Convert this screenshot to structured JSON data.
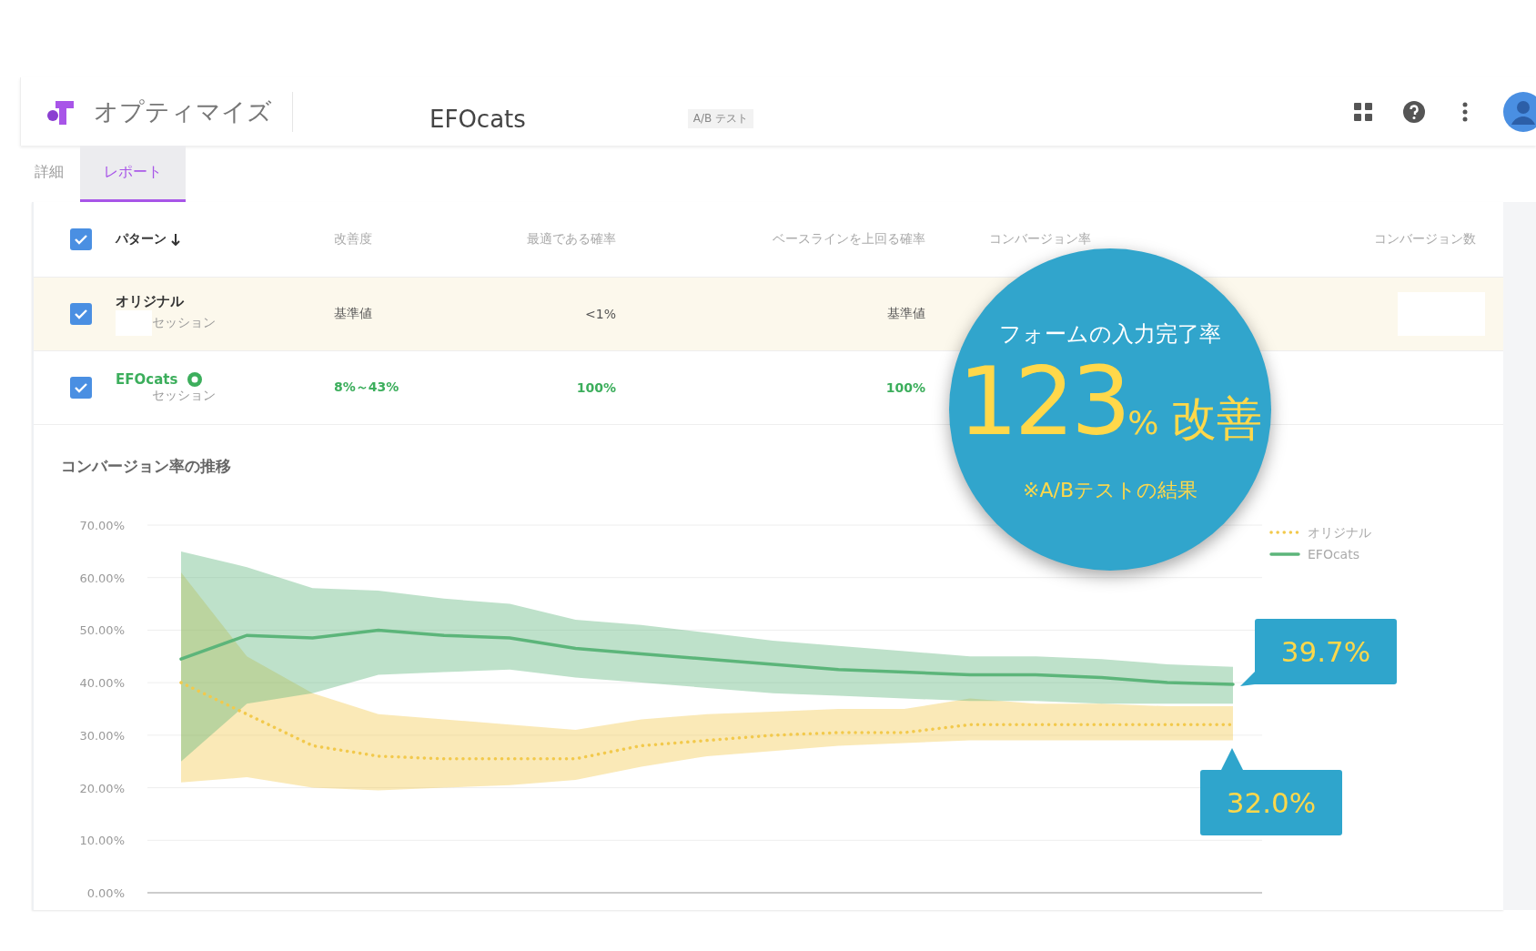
{
  "header": {
    "product": "オプティマイズ",
    "experiment": "EFOcats",
    "badge": "A/B テスト"
  },
  "tabs": [
    {
      "label": "詳細",
      "selected": false
    },
    {
      "label": "レポート",
      "selected": true
    }
  ],
  "table": {
    "all_checked": true,
    "columns": [
      "パターン",
      "改善度",
      "最適である確率",
      "ベースラインを上回る確率",
      "コンバージョン率",
      "コンバージョン数"
    ],
    "rows": [
      {
        "kind": "baseline",
        "checked": true,
        "name": "オリジナル",
        "sessions": "セッション",
        "improvement": "基準値",
        "best_probability": "<1%",
        "beat_baseline": "基準値"
      },
      {
        "kind": "winner",
        "checked": true,
        "name": "EFOcats",
        "sessions": "セッション",
        "improvement": "8%～43%",
        "best_probability": "100%",
        "beat_baseline": "100%"
      }
    ]
  },
  "chart": {
    "title": "コンバージョン率の推移",
    "chart_data": {
      "type": "line",
      "grid": true,
      "legend": true,
      "ylim": [
        0,
        70
      ],
      "yticks": [
        {
          "value": 0,
          "label": "0.00%"
        },
        {
          "value": 10,
          "label": "10.00%"
        },
        {
          "value": 20,
          "label": "20.00%"
        },
        {
          "value": 30,
          "label": "30.00%"
        },
        {
          "value": 40,
          "label": "40.00%"
        },
        {
          "value": 50,
          "label": "50.00%"
        },
        {
          "value": 60,
          "label": "60.00%"
        },
        {
          "value": 70,
          "label": "70.00%"
        }
      ],
      "series": [
        {
          "name": "オリジナル",
          "color": "#f2c94c",
          "line_style": "dotted",
          "values": [
            40,
            34,
            28,
            26,
            25.5,
            25.5,
            25.5,
            28,
            29,
            30,
            30.5,
            30.5,
            32,
            32,
            32,
            32,
            32
          ],
          "upper": [
            61,
            45,
            38,
            34,
            33,
            32,
            31,
            33,
            34,
            34.5,
            35,
            35,
            37,
            36,
            36,
            35.5,
            35.5
          ],
          "lower": [
            21,
            22,
            20,
            19.5,
            20,
            20.5,
            21.5,
            24,
            26,
            27,
            28,
            28.5,
            29,
            29,
            29,
            29,
            29
          ]
        },
        {
          "name": "EFOcats",
          "color": "#5cb57a",
          "line_style": "solid",
          "values": [
            44.5,
            49,
            48.5,
            50,
            49,
            48.5,
            46.5,
            45.5,
            44.5,
            43.5,
            42.5,
            42,
            41.5,
            41.5,
            41,
            40,
            39.7
          ],
          "upper": [
            65,
            62,
            58,
            57.5,
            56,
            55,
            52,
            51,
            49.5,
            48,
            47,
            46,
            45,
            45,
            44.5,
            43.5,
            43
          ],
          "lower": [
            25,
            36,
            38,
            41.5,
            42,
            42.5,
            41,
            40,
            39,
            38,
            37.5,
            37,
            36.5,
            36.5,
            36,
            36,
            36
          ]
        }
      ]
    },
    "callouts": [
      {
        "label": "39.7%"
      },
      {
        "label": "32.0%"
      }
    ]
  },
  "highlight": {
    "caption": "フォームの入力完了率",
    "number": "123",
    "unit": "%",
    "word": "改善",
    "note": "※A/Bテストの結果"
  }
}
